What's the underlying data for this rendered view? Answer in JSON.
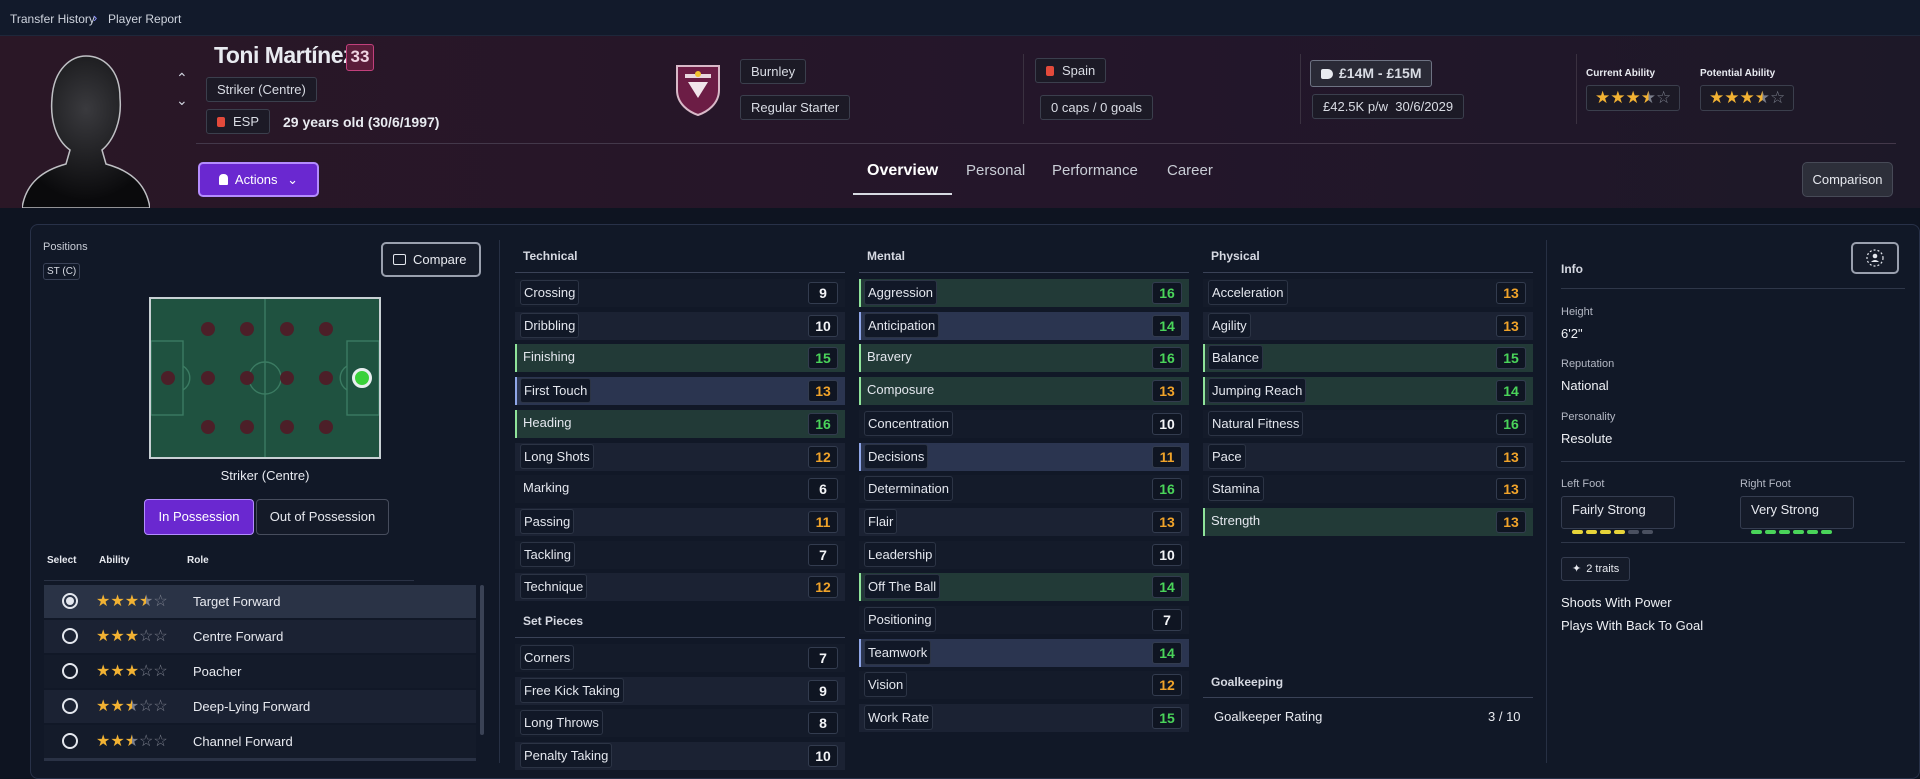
{
  "breadcrumb": {
    "parent": "Transfer History",
    "current": "Player Report"
  },
  "player": {
    "name": "Toni Martínez",
    "age": "33",
    "position": "Striker (Centre)",
    "nation_code": "ESP",
    "age_text": "29 years old (30/6/1997)",
    "club": "Burnley",
    "squad_status": "Regular Starter",
    "nationality": "Spain",
    "caps": "0 caps / 0 goals",
    "value": "£14M - £15M",
    "wage": "£42.5K p/w",
    "contract": "30/6/2029",
    "current_ability_label": "Current Ability",
    "current_ability_stars": 3.5,
    "potential_ability_label": "Potential Ability",
    "potential_ability_stars": 3.5
  },
  "actions_label": "Actions",
  "comparison_label": "Comparison",
  "tabs": [
    "Overview",
    "Personal",
    "Performance",
    "Career"
  ],
  "colors": {
    "accent": "#6a28d0",
    "green": "#4ad45a",
    "amber": "#f0a32a"
  },
  "positions": {
    "title": "Positions",
    "badge": "ST (C)",
    "compare_label": "Compare",
    "pitch_caption": "Striker (Centre)",
    "in_possession": "In Possession",
    "out_of_possession": "Out of Possession",
    "cols": {
      "select": "Select",
      "ability": "Ability",
      "role": "Role"
    },
    "roles": [
      {
        "name": "Target Forward",
        "stars": 3.5,
        "selected": true
      },
      {
        "name": "Centre Forward",
        "stars": 3,
        "selected": false
      },
      {
        "name": "Poacher",
        "stars": 3,
        "selected": false
      },
      {
        "name": "Deep-Lying Forward",
        "stars": 2.5,
        "selected": false
      },
      {
        "name": "Channel Forward",
        "stars": 2.5,
        "selected": false
      }
    ]
  },
  "technical": {
    "title": "Technical",
    "attrs": [
      {
        "name": "Crossing",
        "value": "9"
      },
      {
        "name": "Dribbling",
        "value": "10"
      },
      {
        "name": "Finishing",
        "value": "15"
      },
      {
        "name": "First Touch",
        "value": "13"
      },
      {
        "name": "Heading",
        "value": "16"
      },
      {
        "name": "Long Shots",
        "value": "12"
      },
      {
        "name": "Marking",
        "value": "6"
      },
      {
        "name": "Passing",
        "value": "11"
      },
      {
        "name": "Tackling",
        "value": "7"
      },
      {
        "name": "Technique",
        "value": "12"
      }
    ]
  },
  "set_pieces": {
    "title": "Set Pieces",
    "attrs": [
      {
        "name": "Corners",
        "value": "7"
      },
      {
        "name": "Free Kick Taking",
        "value": "9"
      },
      {
        "name": "Long Throws",
        "value": "8"
      },
      {
        "name": "Penalty Taking",
        "value": "10"
      }
    ]
  },
  "mental": {
    "title": "Mental",
    "attrs": [
      {
        "name": "Aggression",
        "value": "16"
      },
      {
        "name": "Anticipation",
        "value": "14"
      },
      {
        "name": "Bravery",
        "value": "16"
      },
      {
        "name": "Composure",
        "value": "13"
      },
      {
        "name": "Concentration",
        "value": "10"
      },
      {
        "name": "Decisions",
        "value": "11"
      },
      {
        "name": "Determination",
        "value": "16"
      },
      {
        "name": "Flair",
        "value": "13"
      },
      {
        "name": "Leadership",
        "value": "10"
      },
      {
        "name": "Off The Ball",
        "value": "14"
      },
      {
        "name": "Positioning",
        "value": "7"
      },
      {
        "name": "Teamwork",
        "value": "14"
      },
      {
        "name": "Vision",
        "value": "12"
      },
      {
        "name": "Work Rate",
        "value": "15"
      }
    ]
  },
  "physical": {
    "title": "Physical",
    "attrs": [
      {
        "name": "Acceleration",
        "value": "13"
      },
      {
        "name": "Agility",
        "value": "13"
      },
      {
        "name": "Balance",
        "value": "15"
      },
      {
        "name": "Jumping Reach",
        "value": "14"
      },
      {
        "name": "Natural Fitness",
        "value": "16"
      },
      {
        "name": "Pace",
        "value": "13"
      },
      {
        "name": "Stamina",
        "value": "13"
      },
      {
        "name": "Strength",
        "value": "13"
      }
    ]
  },
  "goalkeeping": {
    "title": "Goalkeeping",
    "label": "Goalkeeper Rating",
    "value": "3 / 10"
  },
  "info": {
    "title": "Info",
    "height_label": "Height",
    "height": "6'2\"",
    "reputation_label": "Reputation",
    "reputation": "National",
    "personality_label": "Personality",
    "personality": "Resolute",
    "left_foot_label": "Left Foot",
    "left_foot": "Fairly Strong",
    "left_foot_level": 4,
    "right_foot_label": "Right Foot",
    "right_foot": "Very Strong",
    "right_foot_level": 6,
    "traits_label": "2 traits",
    "traits": [
      "Shoots With Power",
      "Plays With Back To Goal"
    ]
  }
}
